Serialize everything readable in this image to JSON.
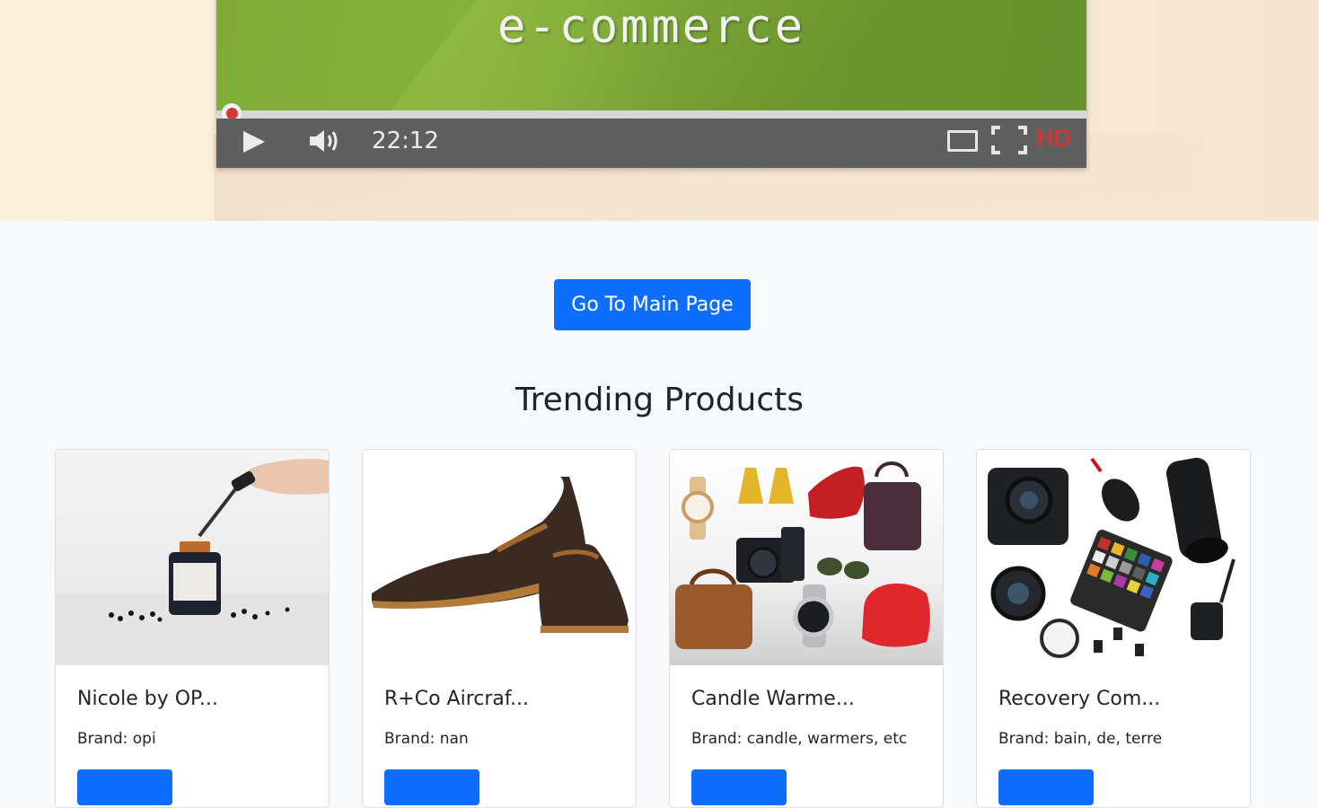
{
  "hero": {
    "video_title": "e-commerce",
    "time": "22:12",
    "hd_label": "HD"
  },
  "main_button_label": "Go To Main Page",
  "section_title": "Trending Products",
  "products": [
    {
      "title": "Nicole by OP...",
      "brand": "Brand: opi"
    },
    {
      "title": "R+Co Aircraf...",
      "brand": "Brand: nan"
    },
    {
      "title": "Candle Warme...",
      "brand": "Brand: candle, warmers, etc"
    },
    {
      "title": "Recovery Com...",
      "brand": "Brand: bain, de, terre"
    }
  ],
  "colors": {
    "primary": "#0d6efd",
    "background": "#f8f9fa",
    "player_green": "#7fab38",
    "player_bar": "#5f5f5f",
    "progress_red": "#d23a3a"
  }
}
